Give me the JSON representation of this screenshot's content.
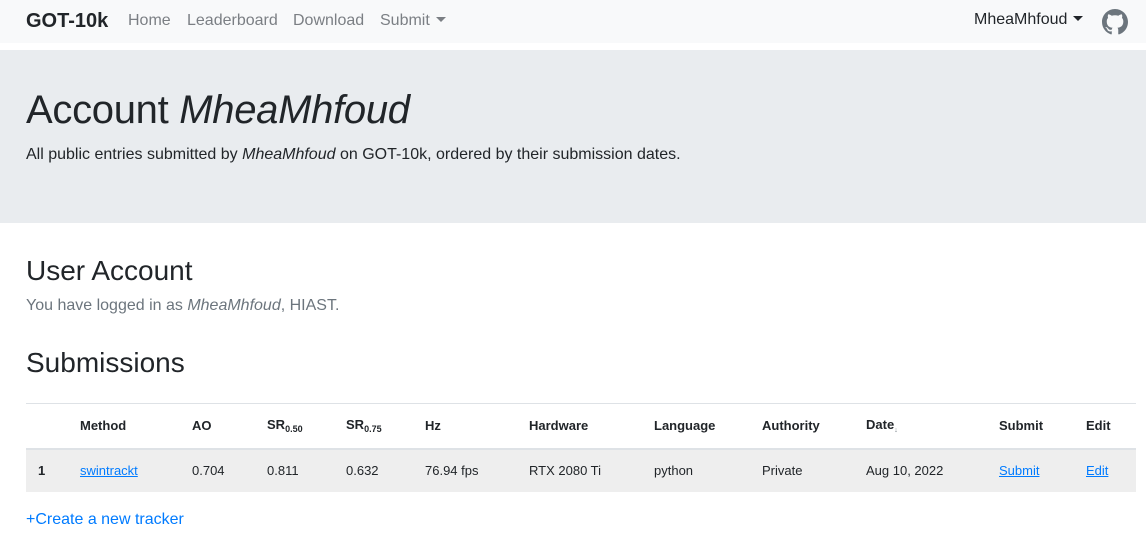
{
  "navbar": {
    "brand": "GOT-10k",
    "links": [
      "Home",
      "Leaderboard",
      "Download"
    ],
    "submit_label": "Submit",
    "user": "MheaMhfoud",
    "github_icon": "github-icon"
  },
  "jumbotron": {
    "title_prefix": "Account",
    "title_user": "MheaMhfoud",
    "desc_prefix": "All public entries submitted by",
    "desc_user": "MheaMhfoud",
    "desc_suffix": "on GOT-10k, ordered by their submission dates."
  },
  "account": {
    "heading": "User Account",
    "logged_prefix": "You have logged in as",
    "logged_user": "MheaMhfoud",
    "logged_suffix": ", HIAST."
  },
  "submissions": {
    "heading": "Submissions",
    "columns": {
      "method": "Method",
      "ao": "AO",
      "sr50_base": "SR",
      "sr50_sub": "0.50",
      "sr75_base": "SR",
      "sr75_sub": "0.75",
      "hz": "Hz",
      "hardware": "Hardware",
      "language": "Language",
      "authority": "Authority",
      "date": "Date",
      "date_sort_glyph": "↓",
      "submit": "Submit",
      "edit": "Edit"
    },
    "rows": [
      {
        "rank": "1",
        "method": "swintrackt",
        "ao": "0.704",
        "sr50": "0.811",
        "sr75": "0.632",
        "hz": "76.94 fps",
        "hardware": "RTX 2080 Ti",
        "language": "python",
        "authority": "Private",
        "date": "Aug 10, 2022",
        "submit": "Submit",
        "edit": "Edit"
      }
    ]
  },
  "create_tracker": "+Create a new tracker",
  "colors": {
    "accent": "#007bff",
    "navbar_bg": "#f8f9fa",
    "jumbotron_bg": "#e9ecef",
    "row_bg": "#eeeeee"
  }
}
